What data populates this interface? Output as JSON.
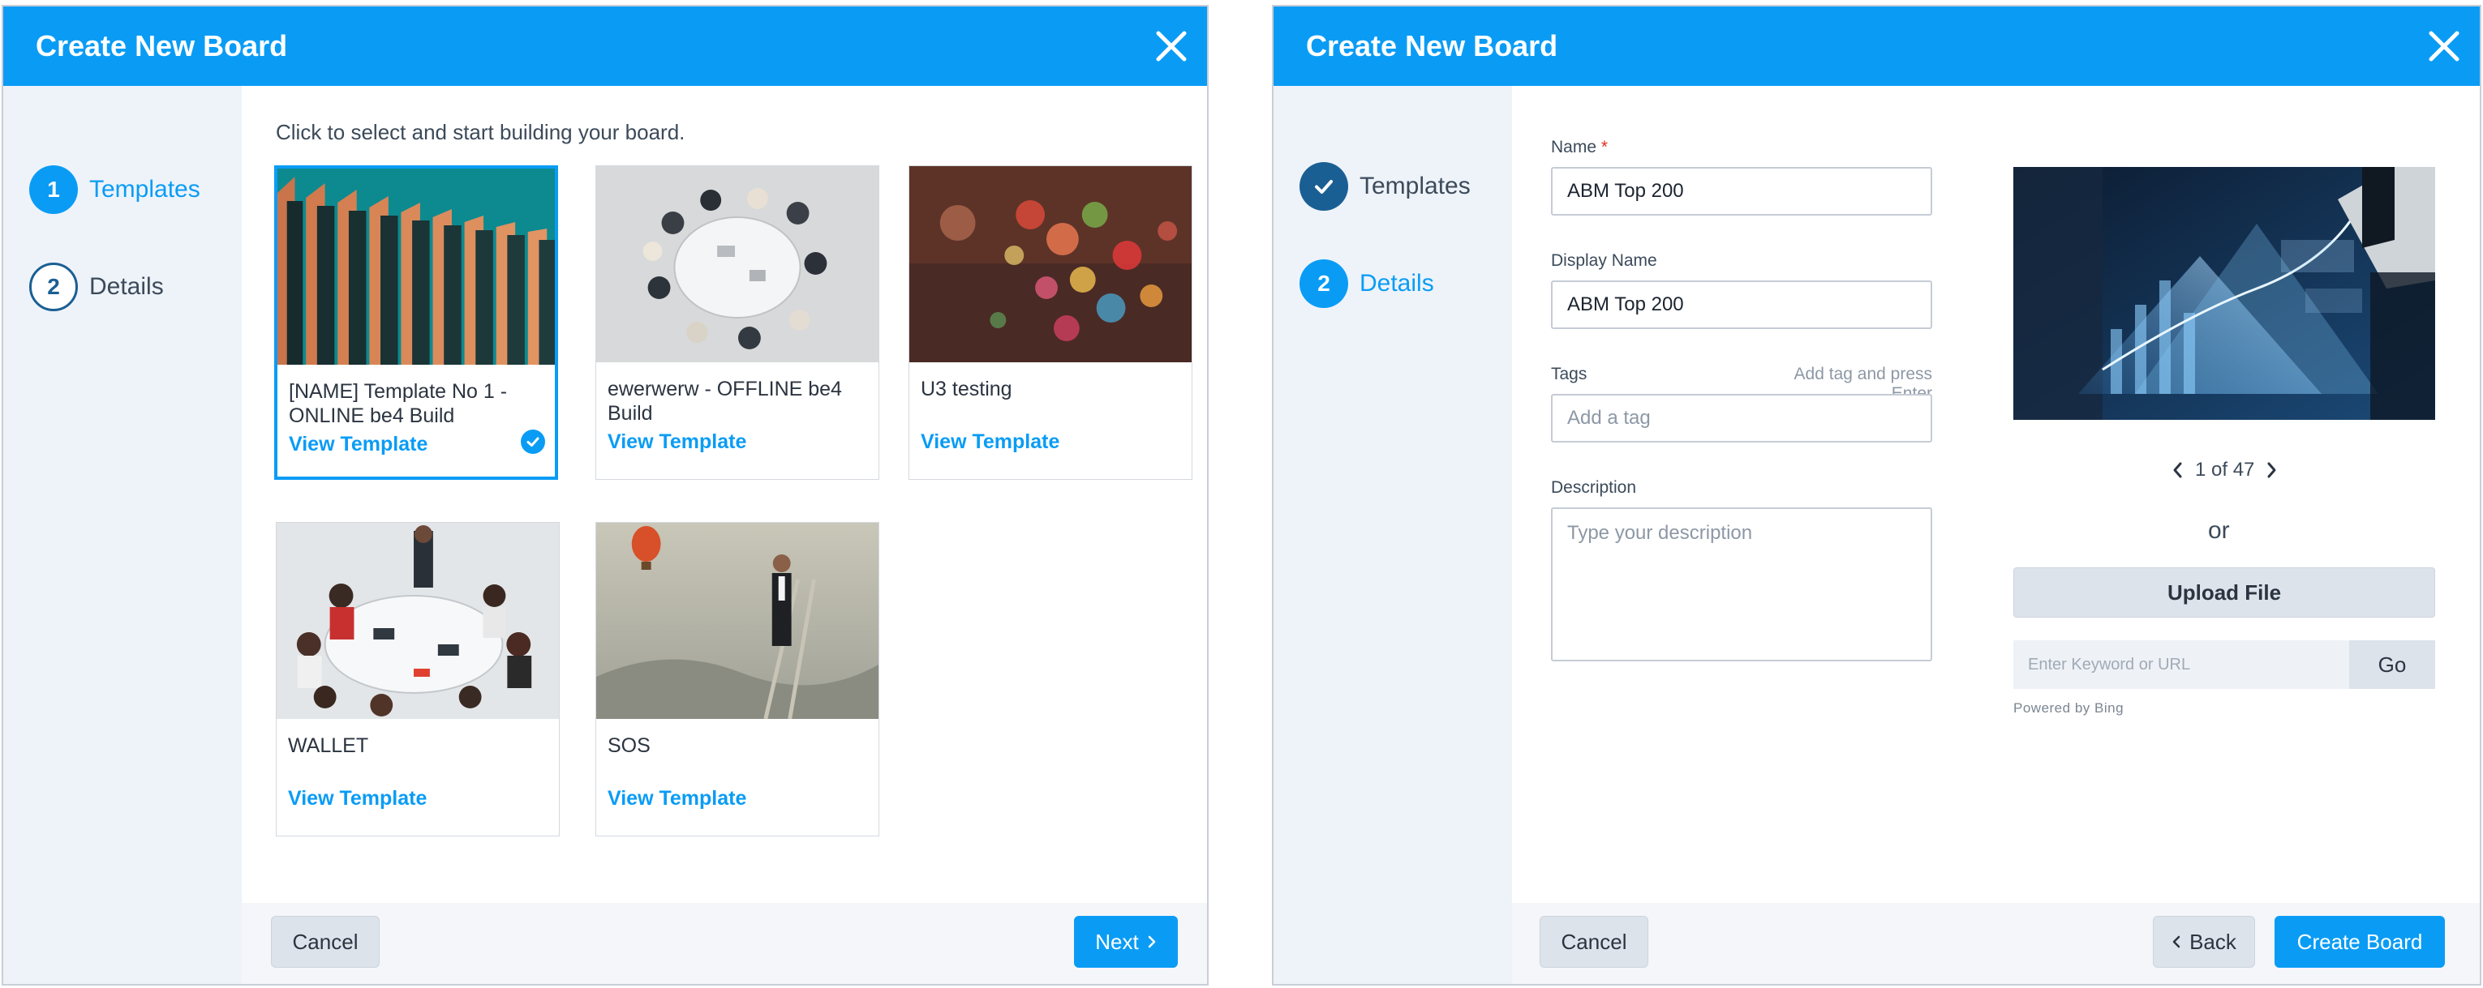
{
  "colors": {
    "primary": "#0a9cf5",
    "dark_step": "#1a5f93",
    "sidebar_bg": "#eef3fa"
  },
  "templates_dialog": {
    "title": "Create New Board",
    "steps": [
      {
        "number": "1",
        "label": "Templates",
        "state": "active"
      },
      {
        "number": "2",
        "label": "Details",
        "state": "pending"
      }
    ],
    "instructions": "Click to select and start building your board.",
    "templates": [
      {
        "name": "[NAME] Template No 1 - ONLINE be4 Build",
        "link": "View Template",
        "selected": true,
        "image": "architecture-columns"
      },
      {
        "name": "ewerwerw - OFFLINE be4 Build",
        "link": "View Template",
        "selected": false,
        "image": "meeting-table-overhead"
      },
      {
        "name": "U3 testing",
        "link": "View Template",
        "selected": false,
        "image": "bokeh-lights"
      },
      {
        "name": "WALLET",
        "link": "View Template",
        "selected": false,
        "image": "team-meeting"
      },
      {
        "name": "SOS",
        "link": "View Template",
        "selected": false,
        "image": "man-on-ladder"
      }
    ],
    "cancel_label": "Cancel",
    "next_label": "Next"
  },
  "details_dialog": {
    "title": "Create New Board",
    "steps": [
      {
        "number": "",
        "label": "Templates",
        "state": "done"
      },
      {
        "number": "2",
        "label": "Details",
        "state": "active"
      }
    ],
    "name_label": "Name",
    "required_mark": "*",
    "name_value": "ABM Top 200",
    "display_name_label": "Display Name",
    "display_name_value": "ABM Top 200",
    "tags_label": "Tags",
    "tags_hint": "Add tag and press Enter",
    "tags_placeholder": "Add a tag",
    "description_label": "Description",
    "description_placeholder": "Type your description",
    "image_pager": "1 of 47",
    "or_text": "or",
    "upload_label": "Upload File",
    "keyword_placeholder": "Enter Keyword or URL",
    "go_label": "Go",
    "powered_by": "Powered by Bing",
    "cancel_label": "Cancel",
    "back_label": "Back",
    "create_label": "Create Board"
  }
}
